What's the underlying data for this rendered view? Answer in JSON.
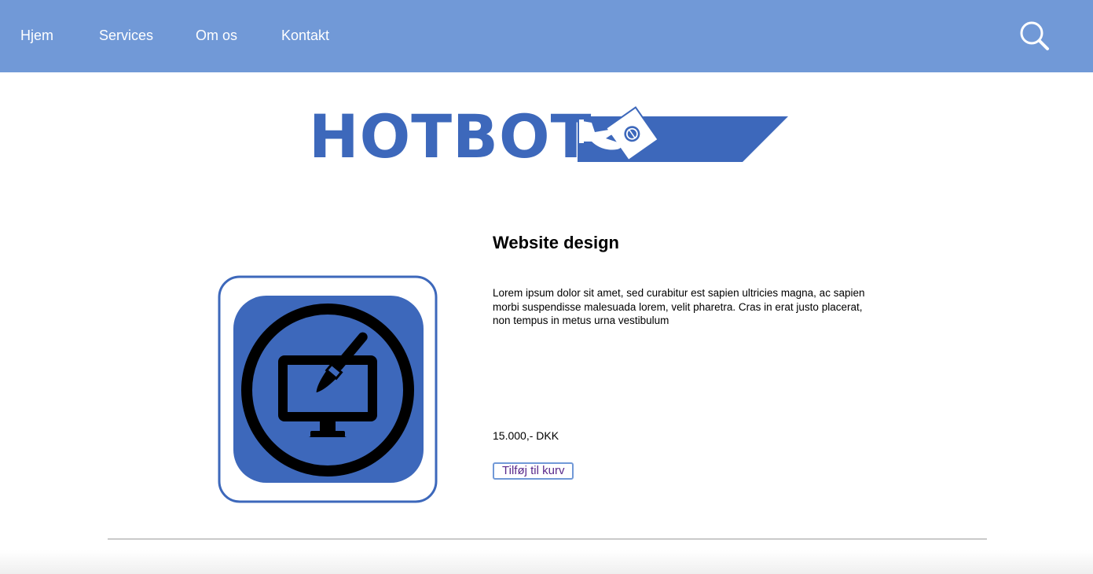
{
  "nav": {
    "items": [
      {
        "label": "Hjem"
      },
      {
        "label": "Services"
      },
      {
        "label": "Om os"
      },
      {
        "label": "Kontakt"
      }
    ],
    "search_icon": "search-icon",
    "background_color": "#7199d7"
  },
  "logo": {
    "text": "HOTBOT",
    "icon": "hand-with-money-icon",
    "brand_color": "#3d68bb"
  },
  "product": {
    "title": "Website design",
    "description": "Lorem ipsum dolor sit amet, sed curabitur est sapien ultricies magna, ac sapien morbi suspendisse malesuada lorem, velit pharetra. Cras in erat justo placerat, non tempus in metus urna vestibulum",
    "price": "15.000,- DKK",
    "add_to_cart_label": "Tilføj til kurv",
    "image_icon": "monitor-paintbrush-icon"
  }
}
